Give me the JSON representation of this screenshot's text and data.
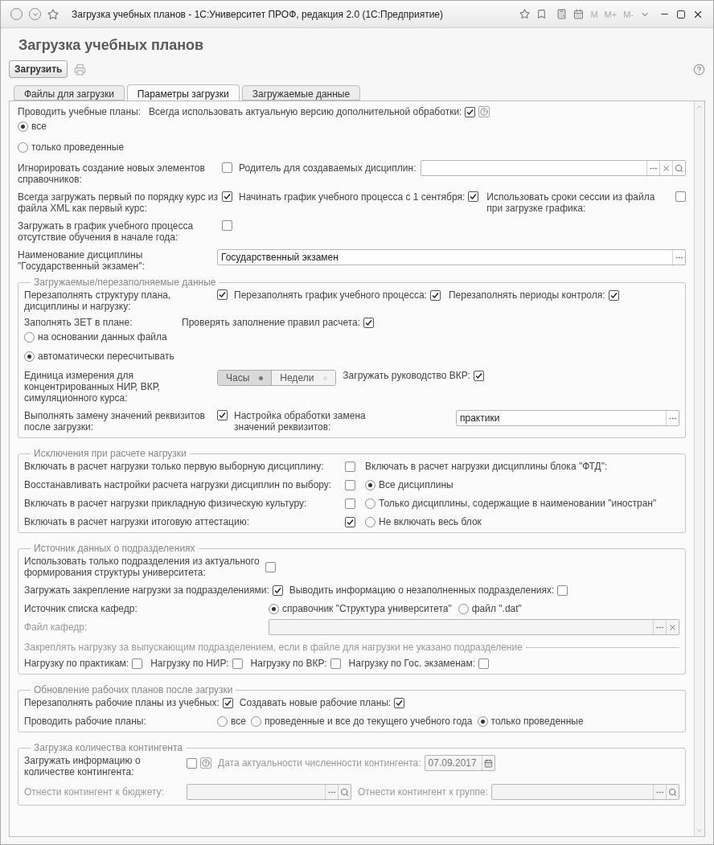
{
  "window": {
    "title": "Загрузка учебных планов - 1С:Университет ПРОФ, редакция 2.0  (1С:Предприятие)",
    "memory_buttons": [
      "M",
      "M+",
      "M-"
    ]
  },
  "form_title": "Загрузка учебных планов",
  "load_button": "Загрузить",
  "tabs": [
    {
      "label": "Файлы для загрузки",
      "selected": false
    },
    {
      "label": "Параметры загрузки",
      "selected": true
    },
    {
      "label": "Загружаемые данные",
      "selected": false
    }
  ],
  "post_plans": {
    "label": "Проводить учебные планы:",
    "options": [
      {
        "label": "все",
        "selected": true
      },
      {
        "label": "только проведенные",
        "selected": false
      }
    ]
  },
  "always_latest": {
    "label": "Всегда использовать актуальную версию дополнительной обработки:",
    "checked": true
  },
  "ignore_new": {
    "label": "Игнорировать создание новых элементов справочников:",
    "checked": false
  },
  "parent_field": {
    "label": "Родитель для создаваемых дисциплин:"
  },
  "first_course": {
    "label": "Всегда загружать первый по порядку курс из файла XML как первый курс:",
    "checked": true
  },
  "september": {
    "label": "Начинать график учебного процесса с 1 сентября:",
    "checked": true
  },
  "session_terms": {
    "label": "Использовать сроки сессии из файла при загрузке графика:",
    "checked": false
  },
  "absence": {
    "label": "Загружать в график учебного процесса отсутствие обучения в начале года:",
    "checked": false
  },
  "exam_name": {
    "label": "Наименование дисциплины \"Государственный экзамен\":",
    "value": "Государственный экзамен"
  },
  "reloaded": {
    "title": "Загружаемые/перезаполняемые данные",
    "refill_structure": {
      "label": "Перезаполнять структуру плана, дисциплины и нагрузку:",
      "checked": true
    },
    "refill_schedule": {
      "label": "Перезаполнять график учебного процесса:",
      "checked": true
    },
    "refill_periods": {
      "label": "Перезаполнять периоды контроля:",
      "checked": true
    },
    "zet": {
      "label": "Заполнять ЗЕТ в плане:",
      "options": [
        {
          "label": "на основании данных файла",
          "selected": false
        },
        {
          "label": "автоматически пересчитывать",
          "selected": true
        }
      ]
    },
    "check_rules": {
      "label": "Проверять заполнение правил расчета:",
      "checked": true
    },
    "unit": {
      "label": "Единица измерения для концентрированных НИР, ВКР, симуляционного курса:",
      "options": [
        {
          "label": "Часы",
          "selected": true
        },
        {
          "label": "Недели",
          "selected": false
        }
      ]
    },
    "vkr_guidance": {
      "label": "Загружать руководство ВКР:",
      "checked": true
    },
    "replace_values": {
      "label": "Выполнять замену значений реквизитов после загрузки:",
      "checked": true
    },
    "replace_settings": {
      "label": "Настройка обработки замена значений реквизитов:",
      "value": "практики"
    }
  },
  "exclusions": {
    "title": "Исключения при расчете нагрузки",
    "checks": [
      {
        "label": "Включать в расчет нагрузки только первую выборную дисциплину:",
        "checked": false
      },
      {
        "label": "Восстанавливать настройки расчета нагрузки дисциплин по выбору:",
        "checked": false
      },
      {
        "label": "Включать в расчет нагрузки прикладную физическую культуру:",
        "checked": false
      },
      {
        "label": "Включать в расчет нагрузки итоговую аттестацию:",
        "checked": true
      }
    ],
    "ftd": {
      "label": "Включать в расчет нагрузки дисциплины блока \"ФТД\":",
      "options": [
        {
          "label": "Все дисциплины",
          "selected": true
        },
        {
          "label": "Только дисциплины, содержащие в наименовании \"иностран\"",
          "selected": false
        },
        {
          "label": "Не включать весь блок",
          "selected": false
        }
      ]
    }
  },
  "departments": {
    "title": "Источник данных о подразделениях",
    "only_actual": {
      "label": "Использовать только подразделения из актуального формирования структуры университета:",
      "checked": false
    },
    "assign_load": {
      "label": "Загружать закрепление нагрузки за подразделениями:",
      "checked": true
    },
    "report_empty": {
      "label": "Выводить информацию о незаполненных подразделениях:",
      "checked": false
    },
    "source": {
      "label": "Источник списка кафедр:",
      "options": [
        {
          "label": "справочник \"Структура университета\"",
          "selected": true
        },
        {
          "label": "файл \".dat\"",
          "selected": false
        }
      ]
    },
    "file": {
      "label": "Файл кафедр:",
      "disabled": true
    },
    "graduating": {
      "title": "Закреплять нагрузку за выпускающим подразделением, если в файле для нагрузки не указано подразделение",
      "checks": [
        {
          "label": "Нагрузку по практикам:",
          "checked": false
        },
        {
          "label": "Нагрузку по НИР:",
          "checked": false
        },
        {
          "label": "Нагрузку по ВКР:",
          "checked": false
        },
        {
          "label": "Нагрузку по Гос. экзаменам:",
          "checked": false
        }
      ]
    }
  },
  "work_plans": {
    "title": "Обновление рабочих планов после загрузки",
    "refill": {
      "label": "Перезаполнять рабочие планы из учебных:",
      "checked": true
    },
    "create_new": {
      "label": "Создавать новые рабочие планы:",
      "checked": true
    },
    "post": {
      "label": "Проводить рабочие планы:",
      "options": [
        {
          "label": "все",
          "selected": false
        },
        {
          "label": "проведенные и все до текущего учебного года",
          "selected": false
        },
        {
          "label": "только проведенные",
          "selected": true
        }
      ]
    }
  },
  "contingent": {
    "title": "Загрузка количества контингента",
    "load_info": {
      "label": "Загружать информацию о количестве контингента:",
      "checked": false
    },
    "date": {
      "label": "Дата актуальности численности контингента:",
      "value": "07.09.2017",
      "disabled": true
    },
    "budget": {
      "label": "Отнести контингент к бюджету:",
      "disabled": true
    },
    "group": {
      "label": "Отнести контингент к группе:",
      "disabled": true
    }
  }
}
